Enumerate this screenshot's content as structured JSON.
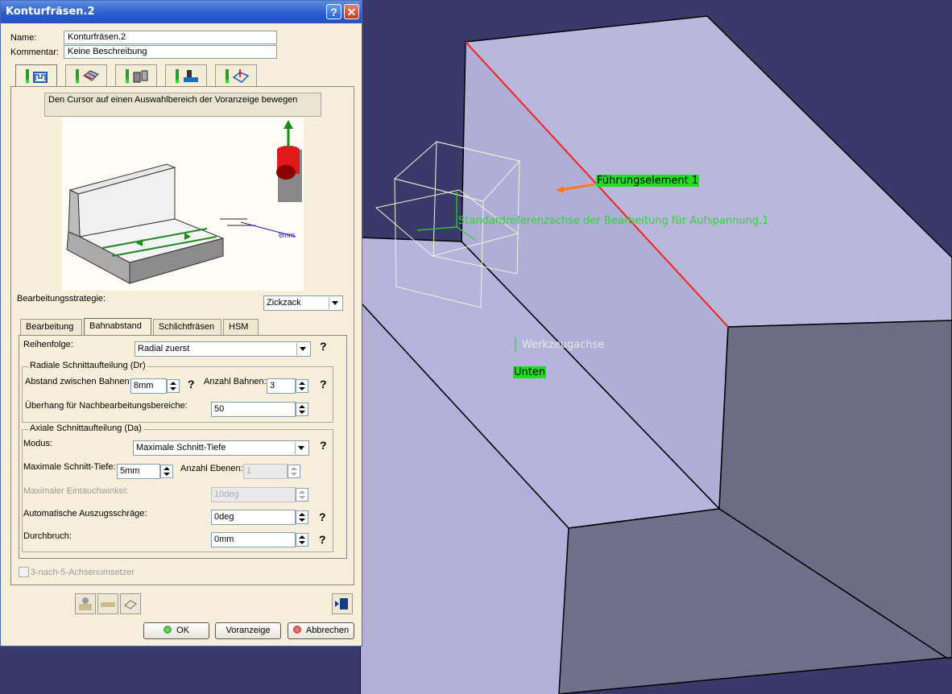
{
  "dialog": {
    "title": "Konturfräsen.2",
    "name_label": "Name:",
    "name_value": "Konturfräsen.2",
    "comment_label": "Kommentar:",
    "comment_value": "Keine Beschreibung",
    "hint_text": "Den Cursor auf einen Auswahlbereich der Voranzeige bewegen",
    "sketch_dimension": "8mm",
    "strategy_label": "Bearbeitungsstrategie:",
    "strategy_value": "Zickzack",
    "subtabs": [
      "Bearbeitung",
      "Bahnabstand",
      "Schlichtfräsen",
      "HSM"
    ],
    "order_label": "Reihenfolge:",
    "order_value": "Radial zuerst",
    "radial_group": "Radiale Schnittaufteilung (Dr)",
    "distance_label": "Abstand zwischen Bahnen:",
    "distance_value": "8mm",
    "num_paths_label": "Anzahl Bahnen:",
    "num_paths_value": "3",
    "overhang_label": "Überhang für Nachbearbeitungsbereiche:",
    "overhang_value": "50",
    "axial_group": "Axiale Schnittaufteilung (Da)",
    "mode_label": "Modus:",
    "mode_value": "Maximale Schnitt-Tiefe",
    "max_depth_label": "Maximale Schnitt-Tiefe:",
    "max_depth_value": "5mm",
    "num_levels_label": "Anzahl Ebenen:",
    "num_levels_value": "1",
    "plunge_label": "Maximaler Eintauchwinkel:",
    "plunge_value": "10deg",
    "draft_label": "Automatische Auszugsschräge:",
    "draft_value": "0deg",
    "breakthrough_label": "Durchbruch:",
    "breakthrough_value": "0mm",
    "converter_label": "3-nach-5-Achsenumsetzer",
    "help_mark": "?",
    "ok_label": "OK",
    "preview_label": "Voranzeige",
    "cancel_label": "Abbrechen"
  },
  "viewport": {
    "guide_label": "Führungselement 1",
    "axis_label": "Standardreferenzachse der Bearbeitung für Aufspannung.1",
    "tool_axis_label": "Werkzeugachse",
    "bottom_label": "Unten",
    "colors": {
      "background": "#3a3a6a",
      "face": "#b4b4dc",
      "edge": "#ff0000",
      "highlight": "#22dd22"
    }
  },
  "icons": [
    "help-icon",
    "close-icon",
    "geometry-tab-icon",
    "strategy-tab-icon",
    "tool-tab-icon",
    "feeds-tab-icon",
    "macros-tab-icon",
    "tool-replay-icon",
    "simulation-icon",
    "analyze-icon",
    "video-icon"
  ]
}
